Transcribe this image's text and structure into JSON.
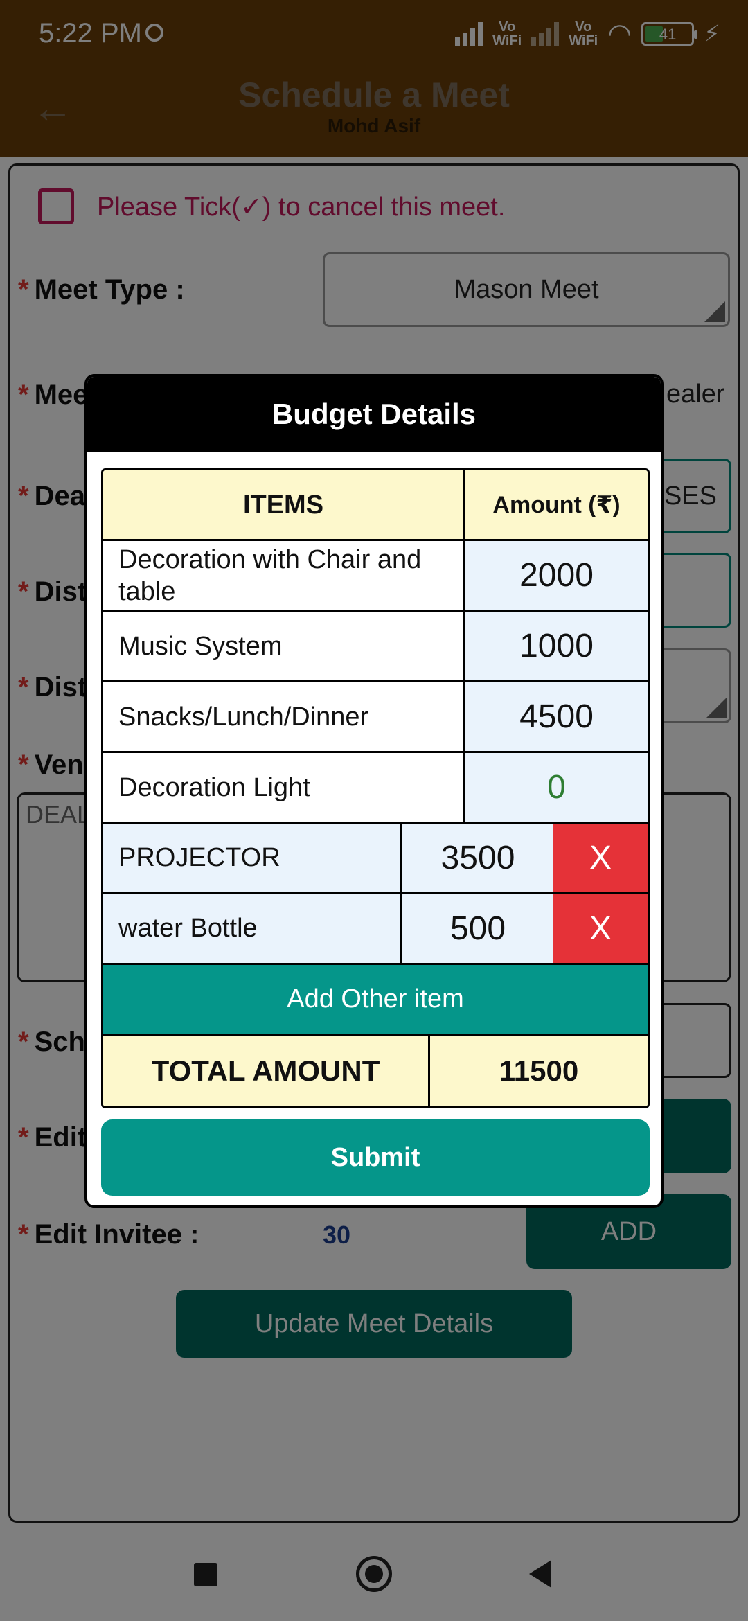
{
  "status_bar": {
    "time": "5:22 PM",
    "vo_label": "Vo",
    "wifi_label": "WiFi",
    "battery": "41"
  },
  "app_bar": {
    "title": "Schedule a Meet",
    "subtitle": "Mohd Asif"
  },
  "form": {
    "cancel_text": "Please Tick(✓) to cancel this meet.",
    "meet_type_label": "Meet Type :",
    "meet_type_value": "Mason Meet",
    "meet_label_partial": "Mee",
    "dealer_radio_partial": "ealer",
    "dealer_label_partial": "Dea",
    "dealer_value_partial": "SES",
    "district_label_partial": "Dist",
    "district2_label_partial": "Dist",
    "venue_label_partial": "Ven",
    "venue_value_partial": "DEAL",
    "schedule_label_partial": "Sch",
    "edit_label_partial": "Edit",
    "edit_invitee_label": "Edit Invitee :",
    "edit_invitee_value": "30",
    "add_button": "ADD",
    "update_button": "Update Meet Details"
  },
  "dialog": {
    "title": "Budget Details",
    "col_items": "ITEMS",
    "col_amount": "Amount (₹)",
    "fixed_items": [
      {
        "name": "Decoration with Chair and table",
        "amount": "2000"
      },
      {
        "name": "Music System",
        "amount": "1000"
      },
      {
        "name": "Snacks/Lunch/Dinner",
        "amount": "4500"
      },
      {
        "name": "Decoration Light",
        "amount": "0"
      }
    ],
    "other_items": [
      {
        "name": "PROJECTOR",
        "amount": "3500",
        "delete": "X"
      },
      {
        "name": "water Bottle",
        "amount": "500",
        "delete": "X"
      }
    ],
    "add_other": "Add Other item",
    "total_label": "TOTAL AMOUNT",
    "total_value": "11500",
    "submit": "Submit"
  },
  "colors": {
    "app_bar": "#6b3f08",
    "teal": "#05968a",
    "delete": "#e53238",
    "header_cell": "#fdf8cc"
  }
}
